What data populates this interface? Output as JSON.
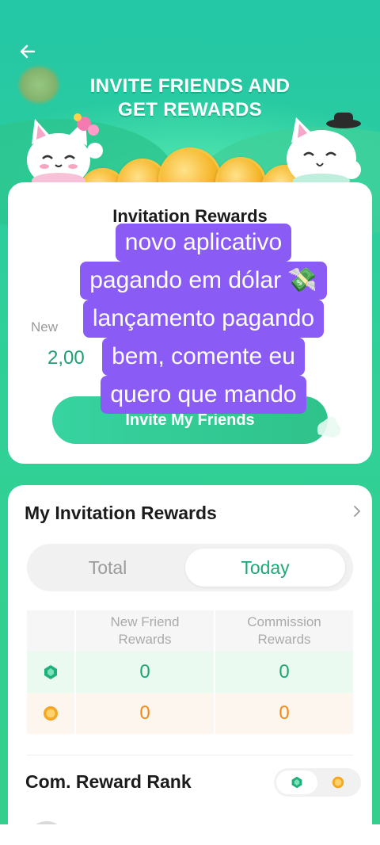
{
  "header": {
    "title": "INVITE FRIENDS AND\nGET REWARDS"
  },
  "invitation_card": {
    "title": "Invitation Rewards",
    "new_label": "New",
    "amount": "2,00",
    "invite_button": "Invite My Friends"
  },
  "caption": {
    "lines": [
      "novo aplicativo",
      "pagando em dólar 💸",
      "lançamento pagando",
      "bem, comente eu",
      "quero que mando"
    ]
  },
  "rewards_card": {
    "title": "My Invitation Rewards",
    "tabs": {
      "total": "Total",
      "today": "Today"
    },
    "selected_tab": "Today",
    "columns": [
      "New Friend\nRewards",
      "Commission\nRewards"
    ],
    "rows": [
      {
        "currency": "green-gem",
        "values": [
          "0",
          "0"
        ]
      },
      {
        "currency": "gold-coin",
        "values": [
          "0",
          "0"
        ]
      }
    ],
    "rank_title": "Com. Reward Rank"
  },
  "colors": {
    "accent_green": "#22a877",
    "orange_value": "#ef8a16",
    "caption_purple": "#8a5cf5"
  }
}
